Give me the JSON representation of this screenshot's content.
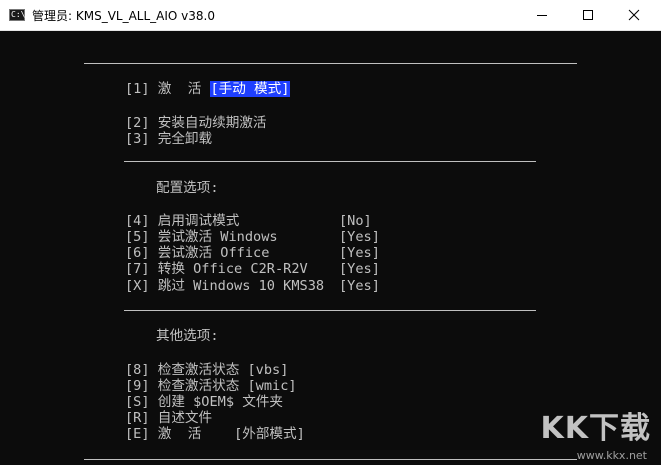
{
  "window": {
    "icon_name": "cmd-icon",
    "icon_glyph": "C:\\",
    "title": "管理员:  KMS_VL_ALL_AIO v38.0",
    "minimize_icon": "minimize-icon",
    "maximize_icon": "maximize-icon",
    "close_icon": "close-icon"
  },
  "menu": {
    "activate": {
      "key": "[1]",
      "label": "激  活",
      "mode": "[手动 模式]"
    },
    "install_auto": {
      "key": "[2]",
      "label": "安装自动续期激活"
    },
    "uninstall": {
      "key": "[3]",
      "label": "完全卸载"
    },
    "config_header": "配置选项:",
    "debug": {
      "key": "[4]",
      "label": "启用调试模式",
      "value": "[No]"
    },
    "try_windows": {
      "key": "[5]",
      "label": "尝试激活 Windows",
      "value": "[Yes]"
    },
    "try_office": {
      "key": "[6]",
      "label": "尝试激活 Office",
      "value": "[Yes]"
    },
    "convert_office": {
      "key": "[7]",
      "label": "转换 Office C2R-R2V",
      "value": "[Yes]"
    },
    "skip_win10": {
      "key": "[X]",
      "label": "跳过 Windows 10 KMS38",
      "value": "[Yes]"
    },
    "other_header": "其他选项:",
    "check_vbs": {
      "key": "[8]",
      "label": "检查激活状态 [vbs]"
    },
    "check_wmic": {
      "key": "[9]",
      "label": "检查激活状态 [wmic]"
    },
    "create_oem": {
      "key": "[S]",
      "label": "创建 $OEM$ 文件夹"
    },
    "readme": {
      "key": "[R]",
      "label": "自述文件"
    },
    "external": {
      "key": "[E]",
      "label": "激  活",
      "mode": "[外部模式]"
    }
  },
  "watermark": {
    "text": "KK下载",
    "url": "www.kkx.net"
  },
  "colors": {
    "console_bg": "#0c0c0c",
    "console_fg": "#c0c0c0",
    "highlight": "#1f3fff"
  }
}
